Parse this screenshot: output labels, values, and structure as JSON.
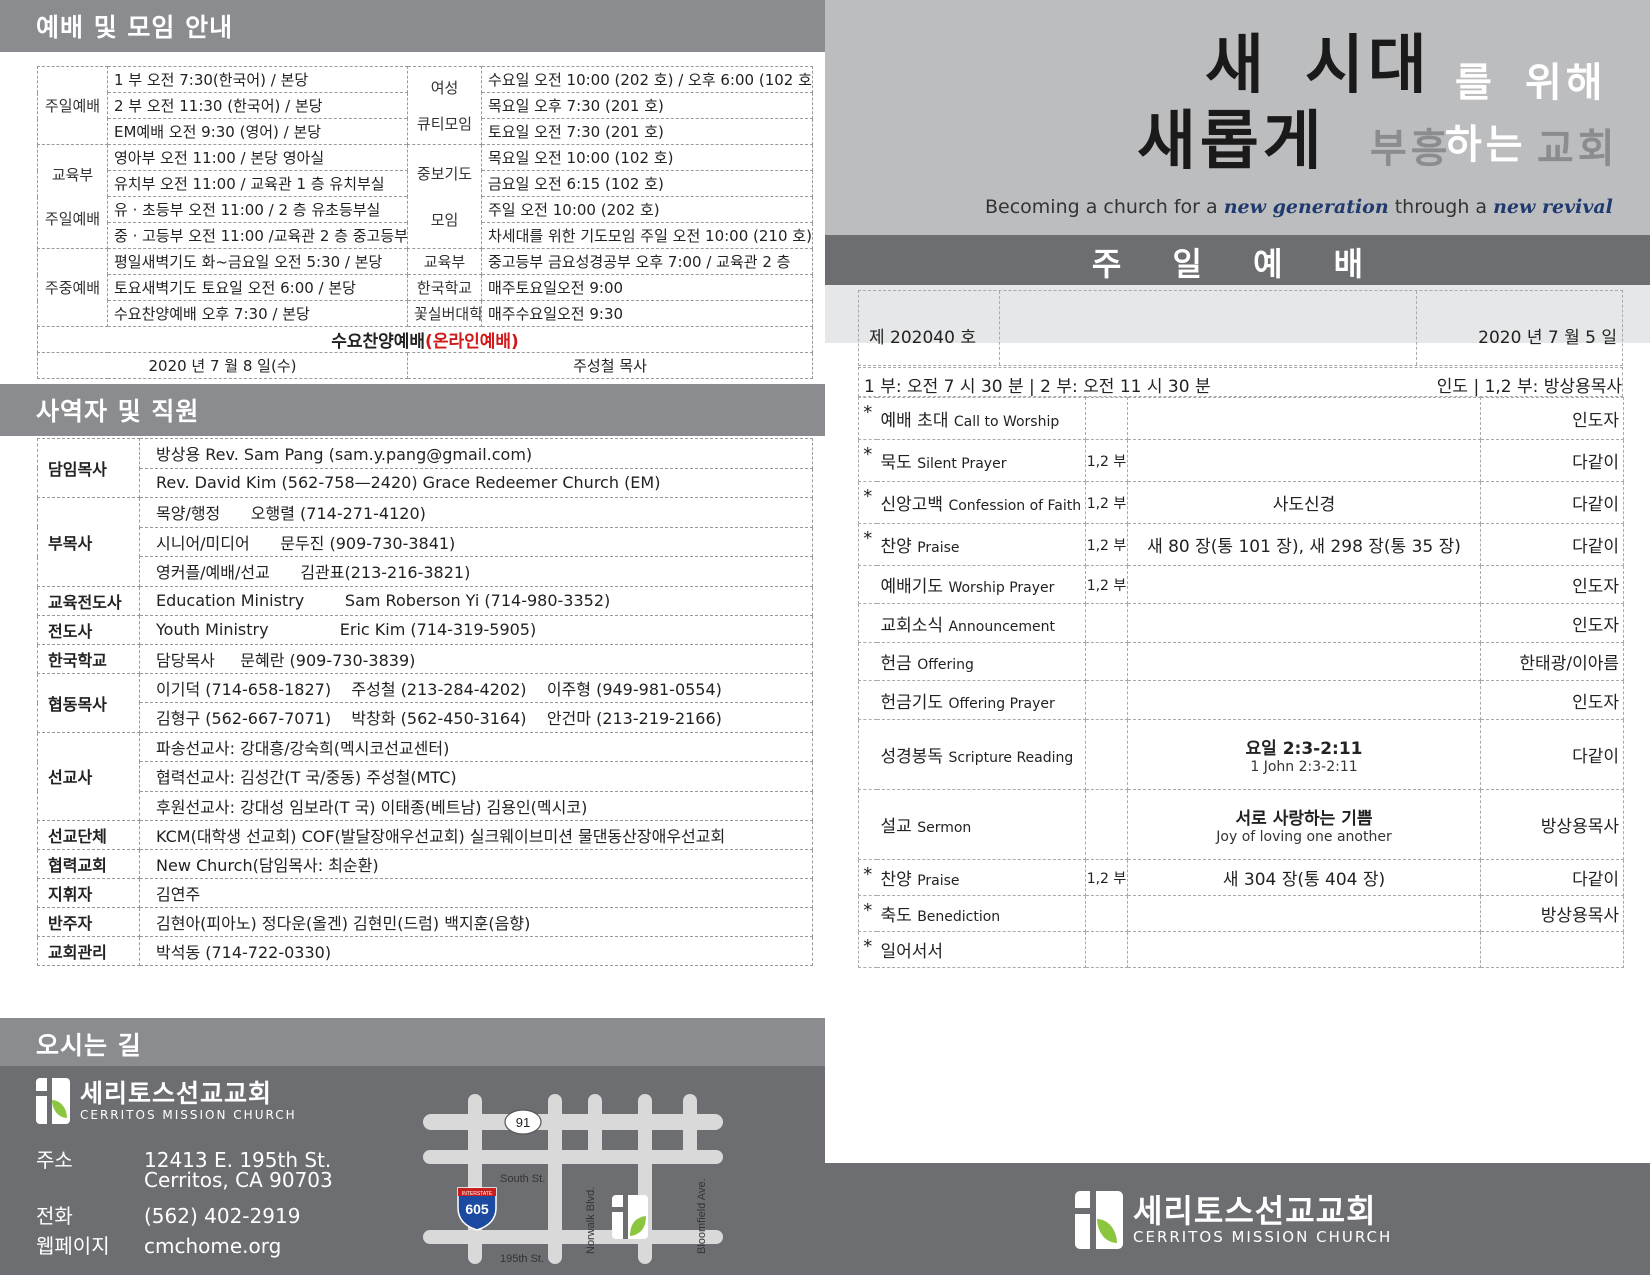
{
  "sections": {
    "worship_info": "예배 및 모임 안내",
    "staff": "사역자 및 직원",
    "directions": "오시는 길"
  },
  "services_left": [
    {
      "label": "주일예배",
      "rows": [
        "1 부 오전 7:30(한국어) / 본당",
        "2 부 오전 11:30 (한국어) / 본당",
        "EM예배 오전 9:30 (영어) / 본당"
      ]
    },
    {
      "label": "교육부\n주일예배",
      "rows": [
        "영아부 오전 11:00 / 본당 영아실",
        "유치부 오전 11:00 / 교육관 1 층 유치부실",
        "유 · 초등부 오전 11:00 / 2 층 유초등부실",
        "중 · 고등부 오전 11:00 /교육관 2 층 중고등부실"
      ]
    },
    {
      "label": "주중예배",
      "rows": [
        "평일새벽기도 화~금요일 오전 5:30 / 본당",
        "토요새벽기도 토요일 오전 6:00 / 본당",
        "수요찬양예배 오후 7:30 / 본당"
      ]
    }
  ],
  "services_right": {
    "women_label_1": "여성",
    "women_label_2": "큐티모임",
    "women_rows": [
      "수요일 오전 10:00 (202 호) / 오후 6:00 (102 호)",
      "목요일 오후 7:30 (201 호)",
      "토요일 오전 7:30 (201 호)"
    ],
    "prayer_label_1": "중보기도",
    "prayer_label_2": "모임",
    "prayer_rows": [
      "목요일 오전 10:00 (102 호)",
      "금요일 오전 6:15 (102 호)",
      "주일 오전 10:00 (202 호)",
      "차세대를 위한 기도모임 주일 오전 10:00 (210 호)"
    ],
    "others": [
      {
        "label": "교육부",
        "value": "중고등부 금요성경공부 오후 7:00 / 교육관 2 층"
      },
      {
        "label": "한국학교",
        "value": "매주토요일오전 9:00"
      },
      {
        "label": "꽃실버대학",
        "value": "매주수요일오전 9:30"
      }
    ]
  },
  "highlight": {
    "main": "수요찬양예배",
    "online": "(온라인예배)"
  },
  "highlight_footer": {
    "date": "2020 년 7 월 8 일(수)",
    "preacher": "주성철 목사"
  },
  "staff": [
    {
      "role": "담임목사",
      "lines": [
        "방상용 Rev. Sam Pang (sam.y.pang@gmail.com)",
        "Rev. David Kim (562-758—2420) Grace Redeemer Church (EM)"
      ]
    },
    {
      "role": "부목사",
      "lines": [
        "목양/행정      오행렬 (714-271-4120)",
        "시니어/미디어      문두진 (909-730-3841)",
        "영커플/예배/선교      김관표(213-216-3821)"
      ]
    },
    {
      "role": "교육전도사",
      "lines": [
        "Education Ministry        Sam Roberson Yi (714-980-3352)"
      ]
    },
    {
      "role": "전도사",
      "lines": [
        "Youth Ministry              Eric Kim (714-319-5905)"
      ]
    },
    {
      "role": "한국학교",
      "lines": [
        "담당목사     문혜란 (909-730-3839)"
      ]
    },
    {
      "role": "협동목사",
      "lines": [
        "이기덕 (714-658-1827)    주성철 (213-284-4202)    이주형 (949-981-0554)",
        "김형구 (562-667-7071)    박창화 (562-450-3164)    안건마 (213-219-2166)"
      ]
    },
    {
      "role": "선교사",
      "lines": [
        "파송선교사: 강대흥/강숙희(멕시코선교센터)",
        "협력선교사: 김성간(T 국/중동) 주성철(MTC)",
        "후원선교사: 강대성 임보라(T 국) 이태종(베트남) 김용인(멕시코)"
      ]
    },
    {
      "role": "선교단체",
      "lines": [
        "KCM(대학생 선교회) COF(발달장애우선교회) 실크웨이브미션 물댄동산장애우선교회"
      ]
    },
    {
      "role": "협력교회",
      "lines": [
        "New Church(담임목사: 최순환)"
      ]
    },
    {
      "role": "지휘자",
      "lines": [
        "김연주"
      ]
    },
    {
      "role": "반주자",
      "lines": [
        "김현아(피아노) 정다운(올겐) 김현민(드럼) 백지훈(음향)"
      ]
    },
    {
      "role": "교회관리",
      "lines": [
        "박석동 (714-722-0330)"
      ]
    }
  ],
  "church": {
    "name_ko": "세리토스선교교회",
    "name_en": "CERRITOS MISSION CHURCH"
  },
  "contact": [
    {
      "key": "주소",
      "value": "12413 E. 195th St."
    },
    {
      "key": "",
      "value": "Cerritos, CA 90703"
    },
    {
      "key": "전화",
      "value": "(562) 402-2919"
    },
    {
      "key": "웹페이지",
      "value": "cmchome.org"
    }
  ],
  "map": {
    "highway_91": "91",
    "highway_605": "605",
    "interstate": "INTERSTATE",
    "south_st": "South St.",
    "st195": "195th St.",
    "norwalk": "Norwalk Blvd.",
    "bloomfield": "Bloomfield Ave."
  },
  "hero": {
    "line1a": "새",
    "line1b": "시대",
    "line1c": "를",
    "line1d": "위해",
    "line2a": "새롭게",
    "line2b": "부흥",
    "line2c": "하는",
    "line2d": "교회",
    "sub_a": "Becoming a church for a ",
    "sub_b": "new generation",
    "sub_c": " through a ",
    "sub_d": "new revival"
  },
  "worship_title": "주 일 예 배",
  "issue": {
    "number": "제 202040 호",
    "date": "2020 년 7 월 5 일"
  },
  "times": {
    "left": "1 부: 오전 7 시 30 분  |  2 부: 오전 11 시 30 분",
    "right": "인도  |  1,2 부: 방상용목사"
  },
  "order": [
    {
      "star": "*",
      "ko": "예배 초대",
      "en": "Call to Worship",
      "part": "",
      "mid": "",
      "mid_en": "",
      "who": "인도자"
    },
    {
      "star": "*",
      "ko": "묵도",
      "en": "Silent Prayer",
      "part": "1,2 부",
      "mid": "",
      "mid_en": "",
      "who": "다같이"
    },
    {
      "star": "*",
      "ko": "신앙고백",
      "en": "Confession of Faith",
      "part": "1,2 부",
      "mid": "사도신경",
      "mid_en": "",
      "who": "다같이"
    },
    {
      "star": "*",
      "ko": "찬양",
      "en": "Praise",
      "part": "1,2 부",
      "mid": "새 80 장(통 101 장), 새 298 장(통 35 장)",
      "mid_en": "",
      "who": "다같이"
    },
    {
      "star": "",
      "ko": "예배기도",
      "en": "Worship Prayer",
      "part": "1,2 부",
      "mid": "",
      "mid_en": "",
      "who": "인도자"
    },
    {
      "star": "",
      "ko": "교회소식",
      "en": "Announcement",
      "part": "",
      "mid": "",
      "mid_en": "",
      "who": "인도자"
    },
    {
      "star": "",
      "ko": "헌금",
      "en": "Offering",
      "part": "",
      "mid": "",
      "mid_en": "",
      "who": "한태광/이아름"
    },
    {
      "star": "",
      "ko": "헌금기도",
      "en": "Offering Prayer",
      "part": "",
      "mid": "",
      "mid_en": "",
      "who": "인도자"
    },
    {
      "star": "",
      "ko": "성경봉독",
      "en": "Scripture Reading",
      "part": "",
      "mid": "요일 2:3-2:11",
      "mid_en": "1 John 2:3-2:11",
      "who": "다같이"
    },
    {
      "star": "",
      "ko": "설교",
      "en": "Sermon",
      "part": "",
      "mid": "서로 사랑하는 기쁨",
      "mid_en": "Joy of loving one another",
      "who": "방상용목사"
    },
    {
      "star": "*",
      "ko": "찬양",
      "en": "Praise",
      "part": "1,2 부",
      "mid": "새 304 장(통 404 장)",
      "mid_en": "",
      "who": "다같이"
    },
    {
      "star": "*",
      "ko": "축도",
      "en": "Benediction",
      "part": "",
      "mid": "",
      "mid_en": "",
      "who": "방상용목사"
    },
    {
      "star": "*",
      "ko": "일어서서",
      "en": "",
      "part": "",
      "mid": "",
      "mid_en": "",
      "who": ""
    }
  ],
  "colors": {
    "dark_gray": "#6d6e71",
    "mid_gray": "#8a8c8f",
    "light_gray": "#bcbdbf",
    "red": "#d01818",
    "leaf_green": "#8cc63f",
    "navy": "#1f3a6e"
  }
}
